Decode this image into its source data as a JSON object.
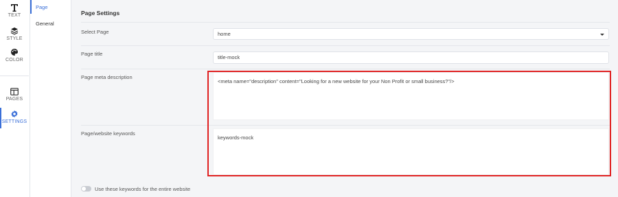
{
  "rail": {
    "items": [
      {
        "label": "TEXT",
        "icon": "text-icon"
      },
      {
        "label": "STYLE",
        "icon": "layers-icon"
      },
      {
        "label": "COLOR",
        "icon": "palette-icon"
      },
      {
        "label": "PAGES",
        "icon": "pages-icon"
      },
      {
        "label": "SETTINGS",
        "icon": "gear-icon",
        "active": true
      }
    ]
  },
  "subnav": {
    "items": [
      {
        "label": "Page",
        "active": true
      },
      {
        "label": "General"
      }
    ]
  },
  "main": {
    "title": "Page Settings",
    "select_page": {
      "label": "Select Page",
      "value": "home"
    },
    "page_title": {
      "label": "Page title",
      "value": "title-mock"
    },
    "meta_description": {
      "label": "Page meta description",
      "value": "<meta name=\"description\" content=\"Looking for a new website for your Non Profit or small business?\"/>"
    },
    "keywords": {
      "label": "Page/website keywords",
      "value": "keywords-mock"
    },
    "toggle": {
      "label": "Use these keywords for the entire website",
      "on": false
    }
  },
  "colors": {
    "accent": "#3a6fd8",
    "highlight": "#e02020"
  }
}
